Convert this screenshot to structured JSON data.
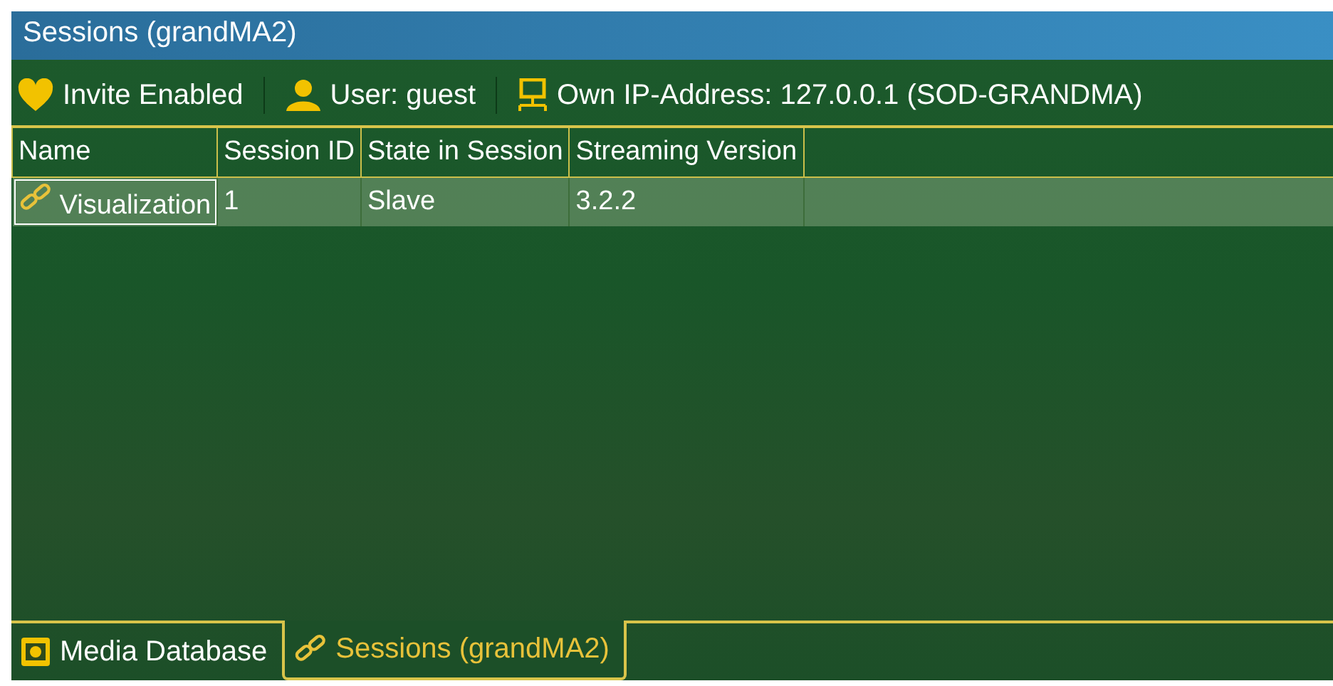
{
  "window": {
    "title": "Sessions (grandMA2)"
  },
  "toolbar": [
    {
      "kind": "heart",
      "label": "Invite Enabled"
    },
    {
      "kind": "user",
      "label": "User: guest"
    },
    {
      "kind": "network",
      "label": "Own IP-Address: 127.0.0.1 (SOD-GRANDMA)"
    }
  ],
  "table": {
    "columns": [
      "Name",
      "Session ID",
      "State in Session",
      "Streaming Version"
    ],
    "rows": [
      {
        "selected": true,
        "cells": [
          "Visualization",
          "1",
          "Slave",
          "3.2.2"
        ]
      }
    ]
  },
  "tabs": [
    {
      "kind": "media",
      "label": "Media Database",
      "selected": false
    },
    {
      "kind": "link",
      "label": "Sessions (grandMA2)",
      "selected": true
    }
  ]
}
